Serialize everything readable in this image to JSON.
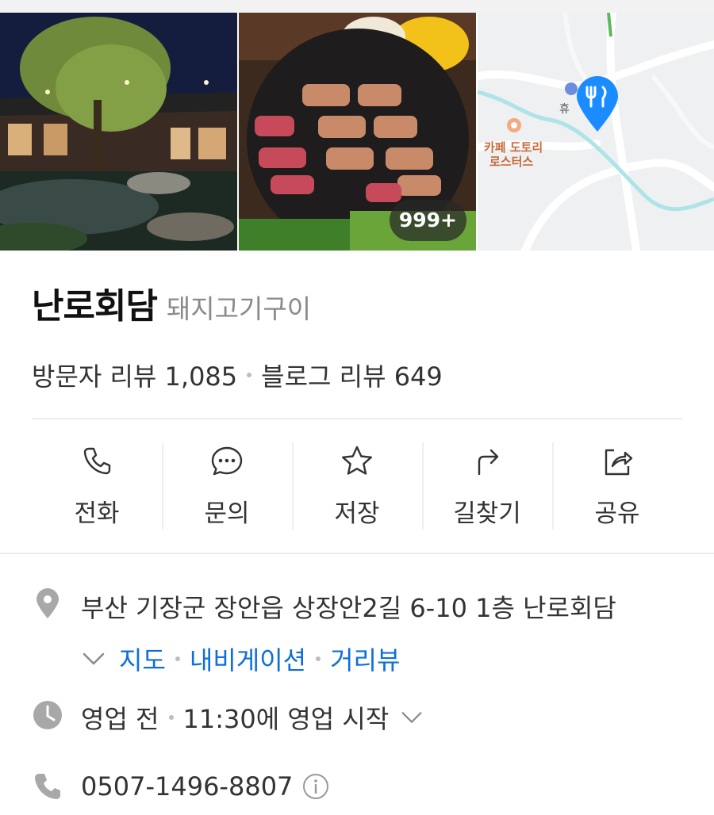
{
  "gallery": {
    "photo_count_badge": "999+",
    "map": {
      "label_cafe": "카페 도토리\n로스터스",
      "label_poi": "휴",
      "pin_icon": "restaurant-pin-icon"
    }
  },
  "place": {
    "name": "난로회담",
    "category": "돼지고기구이",
    "visitor_reviews": "방문자 리뷰 1,085",
    "blog_reviews": "블로그 리뷰 649"
  },
  "actions": [
    {
      "label": "전화",
      "icon": "phone-icon"
    },
    {
      "label": "문의",
      "icon": "chat-icon"
    },
    {
      "label": "저장",
      "icon": "star-icon"
    },
    {
      "label": "길찾기",
      "icon": "directions-icon"
    },
    {
      "label": "공유",
      "icon": "share-icon"
    }
  ],
  "address": {
    "text": "부산 기장군 장안읍 상장안2길 6-10 1층 난로회담",
    "links": [
      "지도",
      "내비게이션",
      "거리뷰"
    ]
  },
  "hours": {
    "status": "영업 전",
    "detail": "11:30에 영업 시작"
  },
  "phone": {
    "number": "0507-1496-8807"
  },
  "colors": {
    "link": "#0e6fd8",
    "pin": "#1a8cff",
    "icon_gray": "#9e9e9e"
  }
}
